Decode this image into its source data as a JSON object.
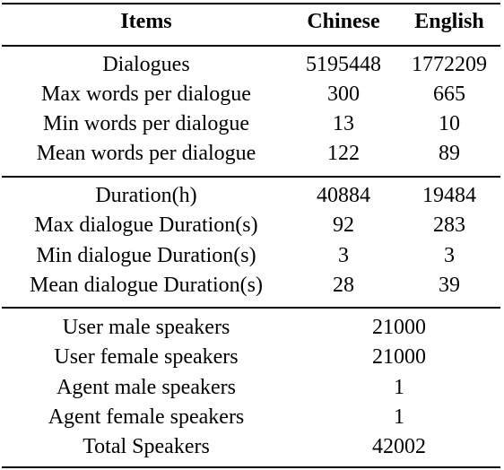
{
  "table": {
    "headers": [
      "Items",
      "Chinese",
      "English"
    ],
    "sections": [
      {
        "rows": [
          {
            "item": "Dialogues",
            "chinese": "5195448",
            "english": "1772209"
          },
          {
            "item": "Max words per dialogue",
            "chinese": "300",
            "english": "665"
          },
          {
            "item": "Min words per dialogue",
            "chinese": "13",
            "english": "10"
          },
          {
            "item": "Mean words per dialogue",
            "chinese": "122",
            "english": "89"
          }
        ]
      },
      {
        "rows": [
          {
            "item": "Duration(h)",
            "chinese": "40884",
            "english": "19484"
          },
          {
            "item": "Max dialogue Duration(s)",
            "chinese": "92",
            "english": "283"
          },
          {
            "item": "Min dialogue Duration(s)",
            "chinese": "3",
            "english": "3"
          },
          {
            "item": "Mean dialogue Duration(s)",
            "chinese": "28",
            "english": "39"
          }
        ]
      },
      {
        "rows": [
          {
            "item": "User male speakers",
            "value": "21000"
          },
          {
            "item": "User female speakers",
            "value": "21000"
          },
          {
            "item": "Agent male speakers",
            "value": "1"
          },
          {
            "item": "Agent female speakers",
            "value": "1"
          },
          {
            "item": "Total Speakers",
            "value": "42002"
          }
        ]
      }
    ]
  }
}
